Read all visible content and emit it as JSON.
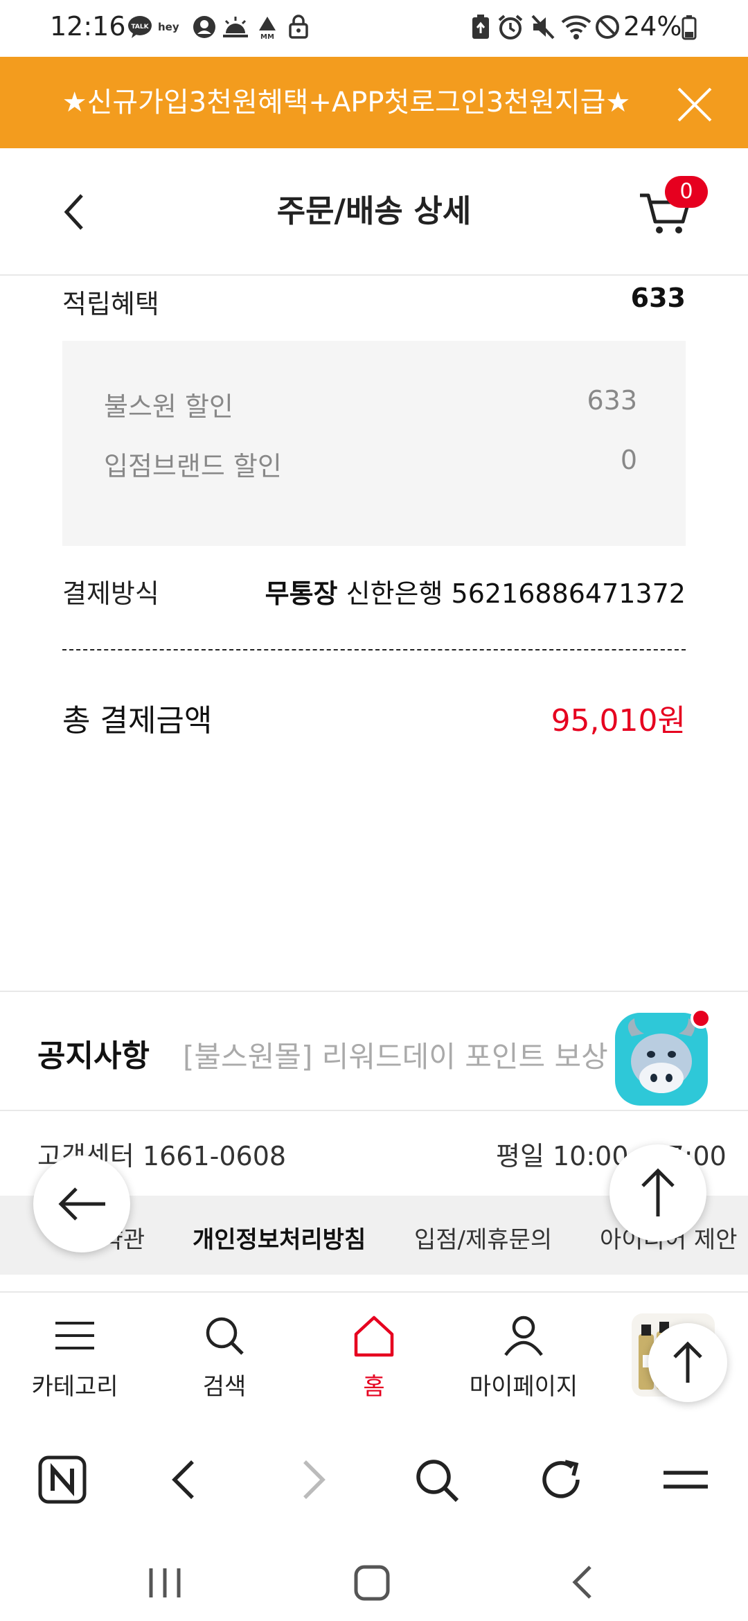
{
  "status_bar": {
    "time": "12:16",
    "battery": "24%",
    "left_icons": [
      "talk-icon",
      "hey-icon",
      "account-icon",
      "sunrise-icon",
      "mm-icon",
      "lock-icon"
    ],
    "right_icons": [
      "battery-saver-icon",
      "alarm-icon",
      "mute-icon",
      "wifi-icon",
      "dnd-icon",
      "battery-icon"
    ]
  },
  "promo": {
    "text": "★신규가입3천원혜택+APP첫로그인3천원지급★"
  },
  "header": {
    "title": "주문/배송 상세",
    "cart_count": "0"
  },
  "order": {
    "reward_label": "적립혜택",
    "reward_value": "633",
    "sub_items": [
      {
        "label": "불스원 할인",
        "value": "633"
      },
      {
        "label": "입점브랜드 할인",
        "value": "0"
      }
    ],
    "payment_label": "결제방식",
    "payment_method": "무통장",
    "payment_detail": "신한은행 56216886471372",
    "total_label": "총 결제금액",
    "total_value": "95,010원"
  },
  "notice": {
    "title": "공지사항",
    "text": "[불스원몰] 리워드데이 포인트 보상"
  },
  "customer_center": {
    "phone": "고객센터 1661-0608",
    "hours": "평일 10:00~17:00"
  },
  "footer_links": [
    "이용약관",
    "개인정보처리방침",
    "입점/제휴문의",
    "아이디어 제안"
  ],
  "app_nav": [
    {
      "label": "카테고리",
      "icon": "menu-icon"
    },
    {
      "label": "검색",
      "icon": "search-icon"
    },
    {
      "label": "홈",
      "icon": "home-icon"
    },
    {
      "label": "마이페이지",
      "icon": "user-icon"
    }
  ],
  "colors": {
    "promo_bg": "#f39c1e",
    "accent_red": "#e6001f",
    "chatbot_bg": "#2ec8d8"
  }
}
